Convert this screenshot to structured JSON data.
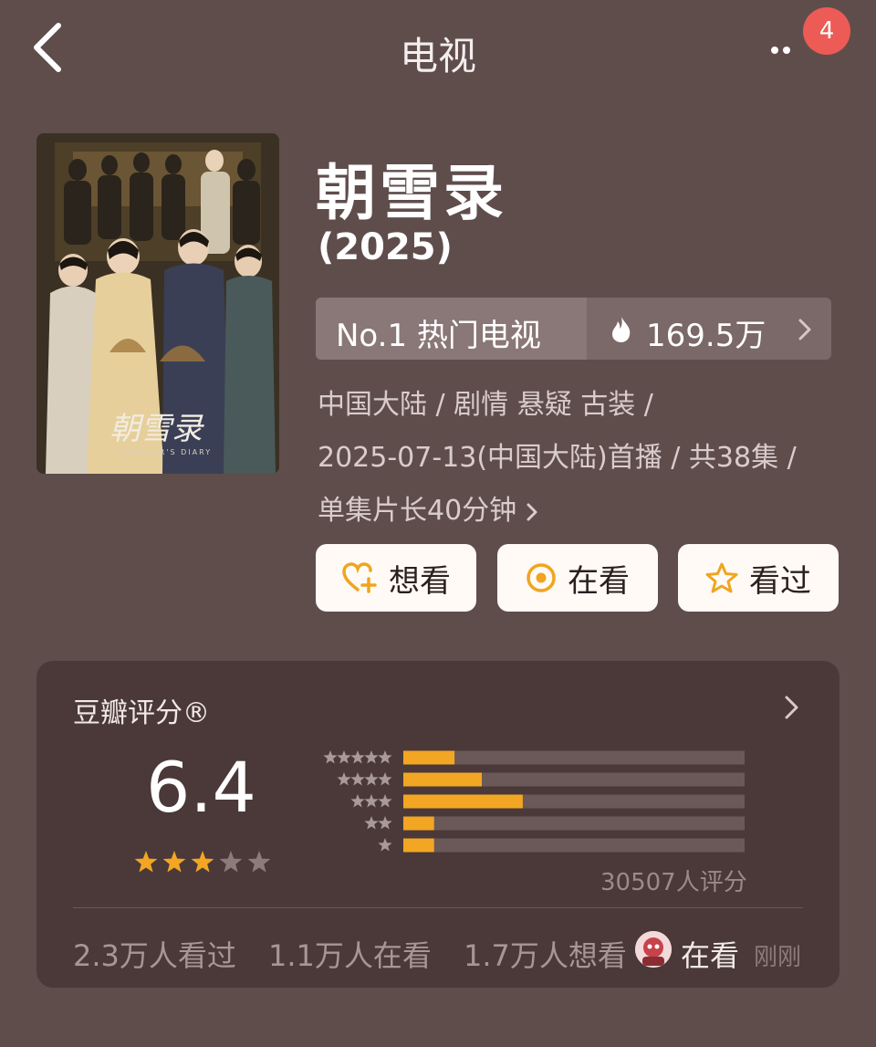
{
  "header": {
    "title": "电视",
    "notification_count": "4"
  },
  "show": {
    "title": "朝雪录",
    "year": "(2025)",
    "rank_label": "No.1 热门电视",
    "heat": "169.5万",
    "meta_line1": "中国大陆 / 剧情 悬疑 古装 /",
    "meta_line2": "2025-07-13(中国大陆)首播 / 共38集 /",
    "meta_line3": "单集片长40分钟"
  },
  "actions": [
    {
      "label": "想看",
      "icon": "heart-plus-icon"
    },
    {
      "label": "在看",
      "icon": "target-icon"
    },
    {
      "label": "看过",
      "icon": "star-outline-icon"
    }
  ],
  "rating": {
    "label": "豆瓣评分®",
    "score": "6.4",
    "stars_filled": 3,
    "stars_total": 5,
    "votes_text": "30507人评分",
    "distribution": [
      {
        "stars": 5,
        "percent": 15
      },
      {
        "stars": 4,
        "percent": 23
      },
      {
        "stars": 3,
        "percent": 35
      },
      {
        "stars": 2,
        "percent": 9
      },
      {
        "stars": 1,
        "percent": 9
      }
    ]
  },
  "stats": {
    "watched": "2.3万人看过",
    "watching": "1.1万人在看",
    "want": "1.7万人想看",
    "friend_status": "在看",
    "friend_time": "刚刚"
  },
  "colors": {
    "background": "#5f4d4c",
    "card": "#4a3938",
    "accent_orange": "#f3a623",
    "badge_red": "#ec5b55"
  }
}
